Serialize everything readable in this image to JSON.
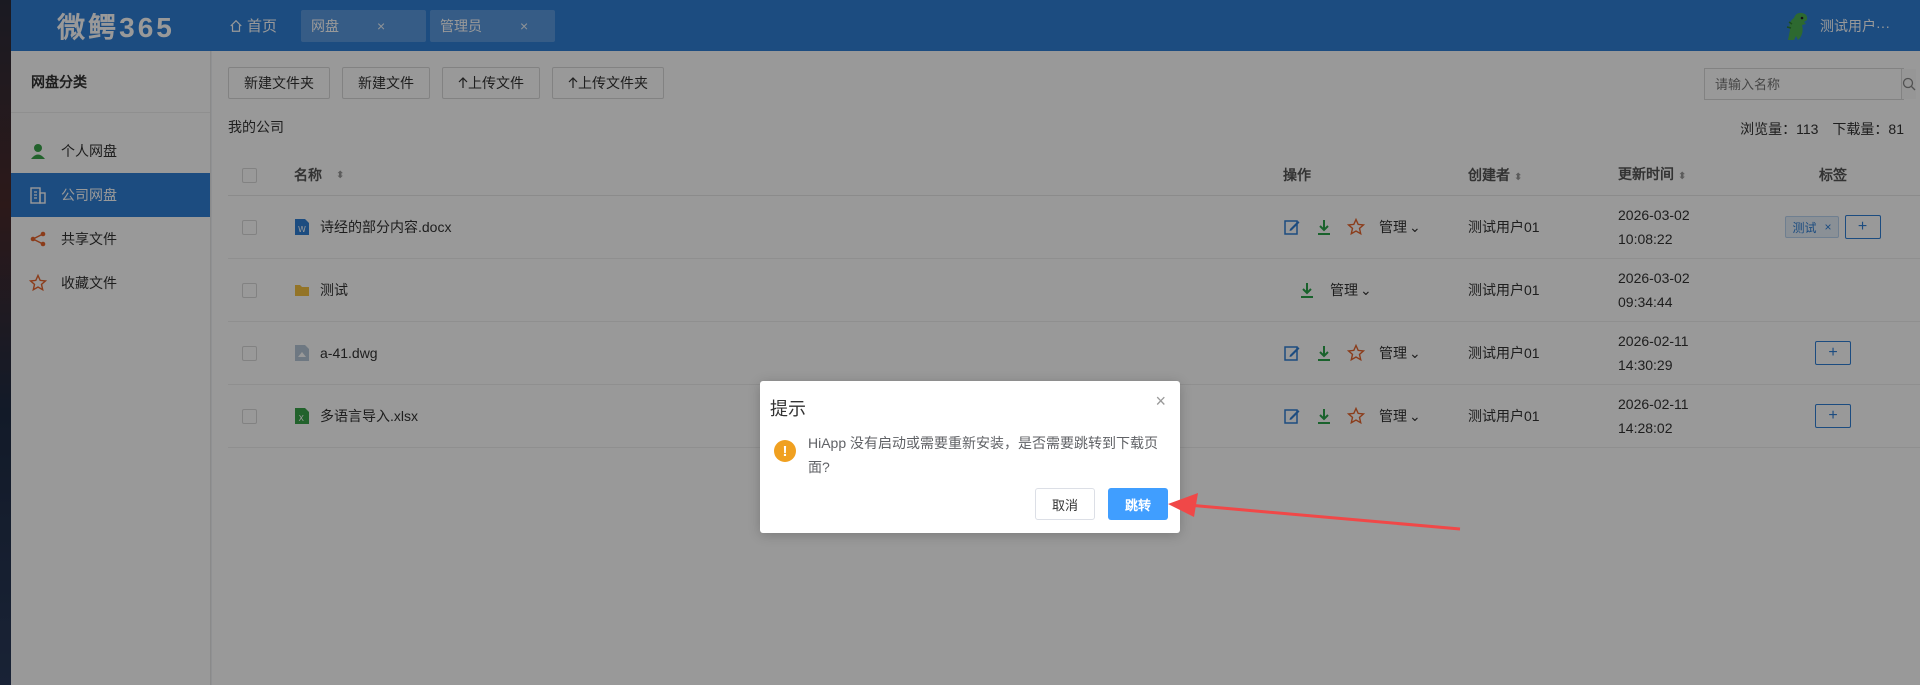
{
  "app": {
    "logo": "微鳄365"
  },
  "nav": {
    "home_label": "首页",
    "tabs": [
      {
        "label": "网盘",
        "close": "×"
      },
      {
        "label": "管理员",
        "close": "×"
      }
    ],
    "user_name": "测试用户···"
  },
  "sidebar": {
    "title": "网盘分类",
    "items": [
      {
        "label": "个人网盘"
      },
      {
        "label": "公司网盘"
      },
      {
        "label": "共享文件"
      },
      {
        "label": "收藏文件"
      }
    ]
  },
  "toolbar": {
    "new_folder": "新建文件夹",
    "new_file": "新建文件",
    "upload_file": "上传文件",
    "upload_folder": "上传文件夹",
    "search_placeholder": "请输入名称"
  },
  "breadcrumb": "我的公司",
  "stats": {
    "views_label": "浏览量：",
    "views": "113",
    "downloads_label": "下载量：",
    "downloads": "81"
  },
  "table": {
    "headers": {
      "name": "名称",
      "ops": "操作",
      "creator": "创建者",
      "updated": "更新时间",
      "tags": "标签"
    },
    "manage_label": "管理",
    "rows": [
      {
        "name": "诗经的部分内容.docx",
        "type": "docx",
        "creator": "测试用户01",
        "date": "2026-03-02",
        "time": "10:08:22",
        "tag": "测试",
        "editable": true
      },
      {
        "name": "测试",
        "type": "folder",
        "creator": "测试用户01",
        "date": "2026-03-02",
        "time": "09:34:44",
        "tag": null,
        "editable": false
      },
      {
        "name": "a-41.dwg",
        "type": "dwg",
        "creator": "测试用户01",
        "date": "2026-02-11",
        "time": "14:30:29",
        "tag": null,
        "editable": true
      },
      {
        "name": "多语言导入.xlsx",
        "type": "xlsx",
        "creator": "测试用户01",
        "date": "2026-02-11",
        "time": "14:28:02",
        "tag": null,
        "editable": true
      }
    ]
  },
  "dialog": {
    "title": "提示",
    "message": "HiApp 没有启动或需要重新安装，是否需要跳转到下载页面?",
    "cancel": "取消",
    "confirm": "跳转",
    "warning_glyph": "!",
    "close_glyph": "×"
  },
  "colors": {
    "primary": "#2f7fd6",
    "dialog_button": "#409eff",
    "warning": "#f0a020",
    "arrow": "#f04848"
  }
}
